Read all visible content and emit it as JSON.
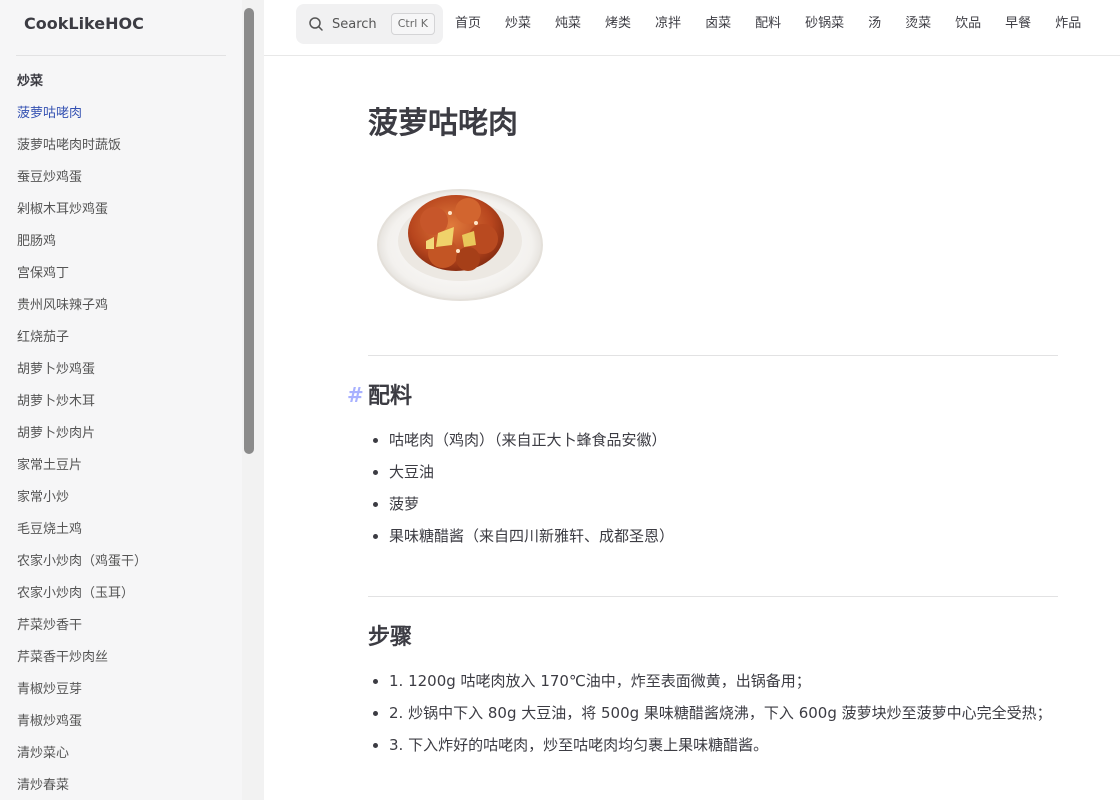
{
  "brand": "CookLikeHOC",
  "sidebar": {
    "group_title": "炒菜",
    "items": [
      "菠萝咕咾肉",
      "菠萝咕咾肉时蔬饭",
      "蚕豆炒鸡蛋",
      "剁椒木耳炒鸡蛋",
      "肥肠鸡",
      "宫保鸡丁",
      "贵州风味辣子鸡",
      "红烧茄子",
      "胡萝卜炒鸡蛋",
      "胡萝卜炒木耳",
      "胡萝卜炒肉片",
      "家常土豆片",
      "家常小炒",
      "毛豆烧土鸡",
      "农家小炒肉（鸡蛋干）",
      "农家小炒肉（玉耳）",
      "芹菜炒香干",
      "芹菜香干炒肉丝",
      "青椒炒豆芽",
      "青椒炒鸡蛋",
      "清炒菜心",
      "清炒春菜"
    ],
    "active_index": 0
  },
  "search": {
    "label": "Search",
    "shortcut": "Ctrl K"
  },
  "topnav": [
    "首页",
    "炒菜",
    "炖菜",
    "烤类",
    "凉拌",
    "卤菜",
    "配料",
    "砂锅菜",
    "汤",
    "烫菜",
    "饮品",
    "早餐",
    "炸品"
  ],
  "page": {
    "title": "菠萝咕咾肉",
    "image_alt": "菠萝咕咾肉",
    "sections": {
      "ingredients": {
        "anchor": "#",
        "title": "配料",
        "items": [
          "咕咾肉（鸡肉）（来自正大卜蜂食品安徽）",
          "大豆油",
          "菠萝",
          "果味糖醋酱（来自四川新雅轩、成都圣恩）"
        ]
      },
      "steps": {
        "title": "步骤",
        "items": [
          {
            "num": "1.",
            "text": "1200g 咕咾肉放入 170℃油中，炸至表面微黄，出锅备用；"
          },
          {
            "num": "2.",
            "text": "炒锅中下入 80g 大豆油，将 500g 果味糖醋酱烧沸，下入 600g 菠萝块炒至菠萝中心完全受热；"
          },
          {
            "num": "3.",
            "text": "下入炸好的咕咾肉，炒至咕咾肉均匀裹上果味糖醋酱。"
          }
        ]
      }
    }
  },
  "colors": {
    "accent": "#3451b2",
    "anchor": "#a8b1ff",
    "sidebar_bg": "#f6f6f7",
    "text": "#3c3c43"
  }
}
